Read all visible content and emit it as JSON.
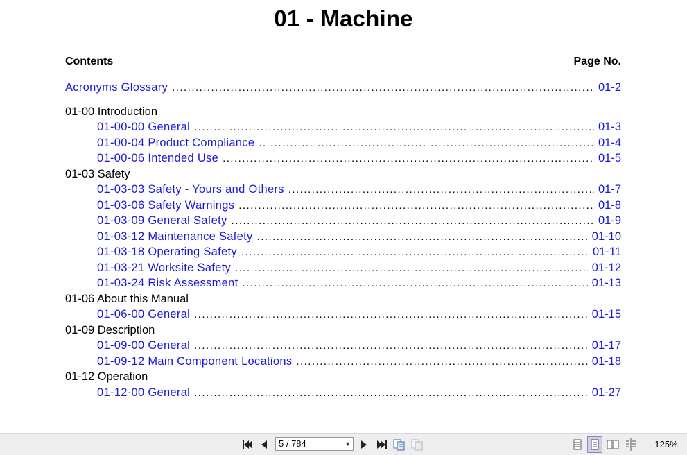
{
  "document": {
    "title": "01 - Machine",
    "contents_header": "Contents",
    "pageno_header": "Page No."
  },
  "toc": [
    {
      "type": "entry",
      "label": "Acronyms Glossary",
      "page": "01-2",
      "indent": false
    },
    {
      "type": "section",
      "label": "01-00 Introduction"
    },
    {
      "type": "entry",
      "label": "01-00-00 General",
      "page": "01-3",
      "indent": true
    },
    {
      "type": "entry",
      "label": "01-00-04 Product Compliance",
      "page": "01-4",
      "indent": true
    },
    {
      "type": "entry",
      "label": "01-00-06 Intended Use",
      "page": "01-5",
      "indent": true
    },
    {
      "type": "section",
      "label": "01-03 Safety"
    },
    {
      "type": "entry",
      "label": "01-03-03 Safety - Yours and Others",
      "page": "01-7",
      "indent": true
    },
    {
      "type": "entry",
      "label": "01-03-06 Safety Warnings",
      "page": "01-8",
      "indent": true
    },
    {
      "type": "entry",
      "label": "01-03-09 General Safety",
      "page": "01-9",
      "indent": true
    },
    {
      "type": "entry",
      "label": "01-03-12 Maintenance Safety",
      "page": "01-10",
      "indent": true
    },
    {
      "type": "entry",
      "label": "01-03-18 Operating Safety",
      "page": "01-11",
      "indent": true
    },
    {
      "type": "entry",
      "label": "01-03-21 Worksite Safety",
      "page": "01-12",
      "indent": true
    },
    {
      "type": "entry",
      "label": "01-03-24 Risk Assessment",
      "page": "01-13",
      "indent": true
    },
    {
      "type": "section",
      "label": "01-06 About this Manual"
    },
    {
      "type": "entry",
      "label": "01-06-00 General",
      "page": "01-15",
      "indent": true
    },
    {
      "type": "section",
      "label": "01-09 Description"
    },
    {
      "type": "entry",
      "label": "01-09-00 General",
      "page": "01-17",
      "indent": true
    },
    {
      "type": "entry",
      "label": "01-09-12 Main Component Locations",
      "page": "01-18",
      "indent": true
    },
    {
      "type": "section",
      "label": "01-12 Operation"
    },
    {
      "type": "entry",
      "label": "01-12-00 General",
      "page": "01-27",
      "indent": true
    }
  ],
  "toolbar": {
    "page_indicator": "5 / 784",
    "zoom": "125%",
    "icons": [
      "first-page-icon",
      "previous-page-icon",
      "next-page-icon",
      "last-page-icon",
      "copy-page-icon",
      "copy-disabled-icon",
      "single-page-view-icon",
      "continuous-view-icon",
      "two-page-view-icon",
      "two-page-continuous-view-icon"
    ]
  }
}
